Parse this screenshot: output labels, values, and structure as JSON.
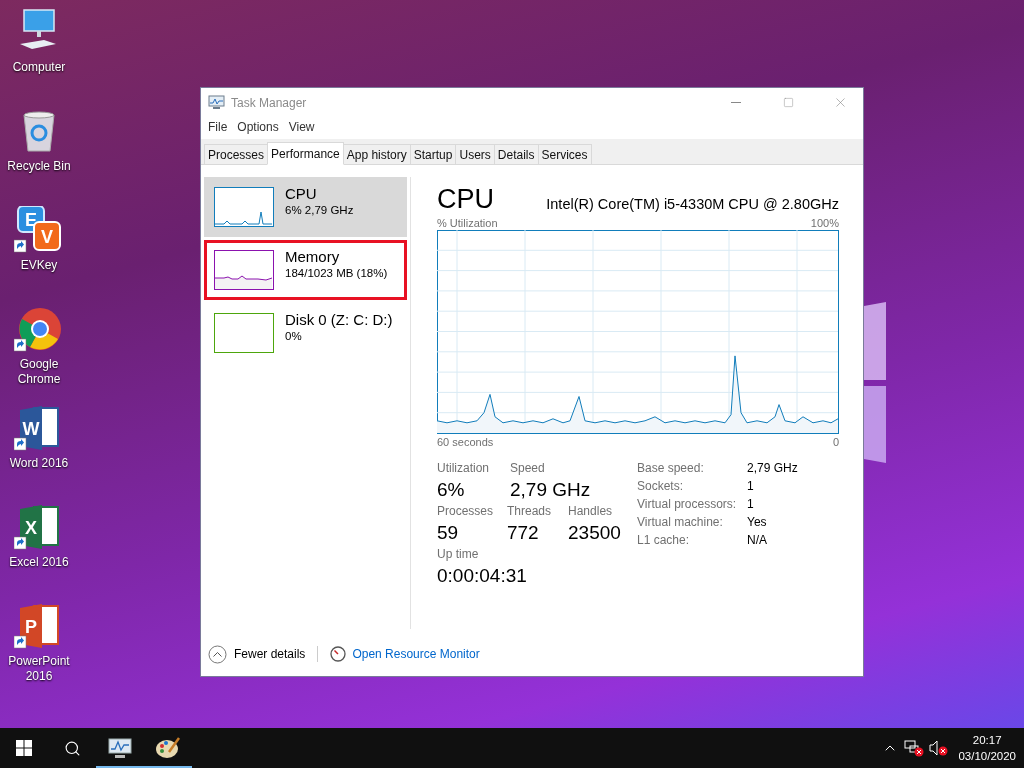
{
  "desktop_icons": [
    {
      "kind": "computer",
      "label": "Computer",
      "shortcut": false
    },
    {
      "kind": "recycle-bin",
      "label": "Recycle Bin",
      "shortcut": false
    },
    {
      "kind": "evkey",
      "label": "EVKey",
      "shortcut": true,
      "icon_text": [
        "E",
        "V"
      ]
    },
    {
      "kind": "chrome",
      "label": "Google Chrome",
      "shortcut": true
    },
    {
      "kind": "word",
      "label": "Word 2016",
      "shortcut": true,
      "icon_text": [
        "W"
      ]
    },
    {
      "kind": "excel",
      "label": "Excel 2016",
      "shortcut": true,
      "icon_text": [
        "X"
      ]
    },
    {
      "kind": "powerpoint",
      "label": "PowerPoint 2016",
      "shortcut": true,
      "icon_text": [
        "P"
      ]
    }
  ],
  "window": {
    "title": "Task Manager",
    "menu": [
      "File",
      "Options",
      "View"
    ],
    "tabs": [
      {
        "label": "Processes",
        "selected": false
      },
      {
        "label": "Performance",
        "selected": true
      },
      {
        "label": "App history",
        "selected": false
      },
      {
        "label": "Startup",
        "selected": false
      },
      {
        "label": "Users",
        "selected": false
      },
      {
        "label": "Details",
        "selected": false
      },
      {
        "label": "Services",
        "selected": false
      }
    ],
    "sidebar": {
      "items": [
        {
          "kind": "cpu",
          "name": "CPU",
          "detail": "6% 2,79 GHz",
          "color": "#117dbb",
          "selected": true,
          "outlined": false
        },
        {
          "kind": "memory",
          "name": "Memory",
          "detail": "184/1023 MB (18%)",
          "color": "#8b12ae",
          "selected": false,
          "outlined": true
        },
        {
          "kind": "disk",
          "name": "Disk 0 (Z: C: D:)",
          "detail": "0%",
          "color": "#4da60c",
          "selected": false,
          "outlined": false
        }
      ]
    },
    "main": {
      "title": "CPU",
      "model": "Intel(R) Core(TM) i5-4330M CPU @ 2.80GHz",
      "graph_label": "% Utilization",
      "graph_max": "100%",
      "graph_span": "60 seconds",
      "graph_end": "0",
      "stat_rows": [
        {
          "items": [
            {
              "label": "Utilization",
              "value": "6%"
            },
            {
              "label": "Speed",
              "value": "2,79 GHz"
            }
          ]
        },
        {
          "items": [
            {
              "label": "Processes",
              "value": "59"
            },
            {
              "label": "Threads",
              "value": "772"
            },
            {
              "label": "Handles",
              "value": "23500"
            }
          ]
        },
        {
          "items": [
            {
              "label": "Up time",
              "value": "0:00:04:31"
            }
          ]
        }
      ],
      "details": [
        {
          "label": "Base speed:",
          "value": "2,79 GHz"
        },
        {
          "label": "Sockets:",
          "value": "1"
        },
        {
          "label": "Virtual processors:",
          "value": "1"
        },
        {
          "label": "Virtual machine:",
          "value": "Yes"
        },
        {
          "label": "L1 cache:",
          "value": "N/A"
        }
      ]
    },
    "footer": {
      "fewer_details": "Fewer details",
      "resource_monitor": "Open Resource Monitor"
    }
  },
  "taskbar": {
    "apps": [
      {
        "kind": "task-manager",
        "open": true
      },
      {
        "kind": "paint",
        "open": true
      }
    ],
    "tray": {
      "network_error": true,
      "volume_muted": true
    },
    "time": "20:17",
    "date": "03/10/2020"
  }
}
